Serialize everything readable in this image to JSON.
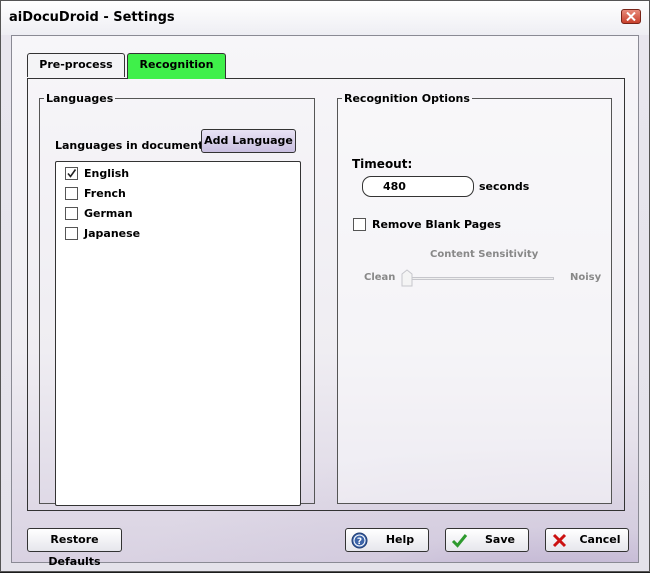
{
  "window": {
    "title": "aiDocuDroid - Settings"
  },
  "tabs": [
    {
      "label": "Pre-process",
      "active": false
    },
    {
      "label": "Recognition",
      "active": true
    }
  ],
  "languages": {
    "group_title": "Languages",
    "in_document_label": "Languages in document:",
    "add_button": "Add Language",
    "items": [
      {
        "label": "English",
        "checked": true
      },
      {
        "label": "French",
        "checked": false
      },
      {
        "label": "German",
        "checked": false
      },
      {
        "label": "Japanese",
        "checked": false
      }
    ]
  },
  "recognition_options": {
    "group_title": "Recognition Options",
    "timeout_label": "Timeout:",
    "timeout_value": "480",
    "timeout_unit": "seconds",
    "remove_blank_pages_label": "Remove Blank Pages",
    "remove_blank_pages_checked": false,
    "sensitivity": {
      "title": "Content Sensitivity",
      "min_label": "Clean",
      "max_label": "Noisy",
      "value": 0,
      "enabled": false
    }
  },
  "buttons": {
    "restore": "Restore Defaults",
    "help": "Help",
    "save": "Save",
    "cancel": "Cancel"
  },
  "icons": {
    "close": "close-icon",
    "help": "help-icon",
    "save": "checkmark-icon",
    "cancel": "x-icon"
  },
  "colors": {
    "active_tab": "#3ff04a",
    "save_check": "#2e9a2e",
    "cancel_x": "#cc1111",
    "close_button": "#c8402c"
  }
}
